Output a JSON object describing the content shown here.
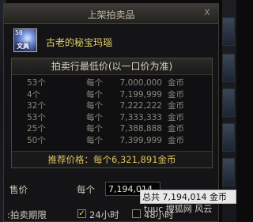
{
  "window": {
    "title": "上架拍卖品",
    "close_label": "x"
  },
  "item": {
    "icon_level": "50",
    "icon_tag": "文具",
    "name": "古老的秘宝玛瑙"
  },
  "panel": {
    "header": "拍卖行最低价(以一口价为准)",
    "rows": [
      {
        "qty": "53个",
        "each": "每个",
        "price": "7,000,000",
        "unit": "金币"
      },
      {
        "qty": "4个",
        "each": "每个",
        "price": "7,199,999",
        "unit": "金币"
      },
      {
        "qty": "32个",
        "each": "每个",
        "price": "7,222,222",
        "unit": "金币"
      },
      {
        "qty": "53个",
        "each": "每个",
        "price": "7,333,333",
        "unit": "金币"
      },
      {
        "qty": "25个",
        "each": "每个",
        "price": "7,388,888",
        "unit": "金币"
      },
      {
        "qty": "50个",
        "each": "每个",
        "price": "7,399,999",
        "unit": "金币"
      }
    ],
    "footer": "推荐价格：每个6,321,891金币"
  },
  "price": {
    "label": "售价",
    "each_label": "每个",
    "value": "7,194,014"
  },
  "tooltip": {
    "text": "总共 7,194,014 金币"
  },
  "watermark": {
    "text": "tuuc 搜狐网 风云"
  },
  "duration": {
    "label": ":拍卖期限",
    "opt1": {
      "label": "24小时",
      "checked": true
    },
    "opt2": {
      "label": "48小时",
      "checked": false
    }
  }
}
